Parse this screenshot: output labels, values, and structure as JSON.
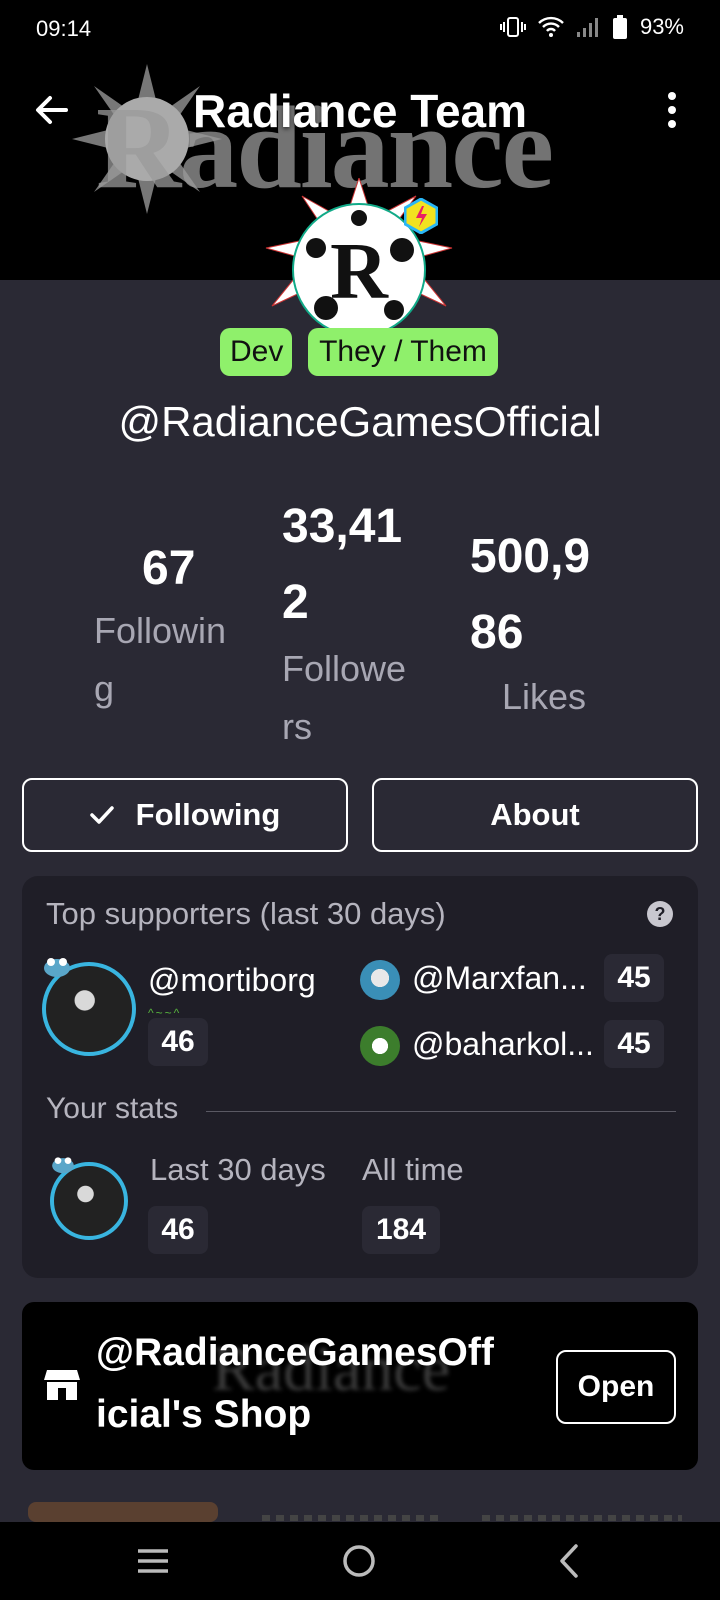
{
  "status_bar": {
    "time": "09:14",
    "battery": "93%"
  },
  "header": {
    "title": "Radiance Team",
    "banner_text": "Radiance"
  },
  "profile": {
    "tags": [
      "Dev",
      "They / Them"
    ],
    "username": "@RadianceGamesOfficial"
  },
  "stats": {
    "following": {
      "value_lines": [
        "67"
      ],
      "label_lines": [
        "Followin",
        "g"
      ]
    },
    "followers": {
      "value_lines": [
        "33,41",
        "2"
      ],
      "label_lines": [
        "Followe",
        "rs"
      ]
    },
    "likes": {
      "value_lines": [
        "500,9",
        "86"
      ],
      "label_lines": [
        "Likes"
      ]
    }
  },
  "actions": {
    "following": "Following",
    "about": "About"
  },
  "supporters": {
    "title": "Top supporters (last 30 days)",
    "top": {
      "name": "@mortiborg",
      "score": "46"
    },
    "others": [
      {
        "name": "@Marxfan...",
        "score": "45"
      },
      {
        "name": "@baharkol...",
        "score": "45"
      }
    ],
    "your_stats_label": "Your stats",
    "last_30_label": "Last 30 days",
    "last_30_value": "46",
    "all_time_label": "All time",
    "all_time_value": "184"
  },
  "shop": {
    "title_lines": [
      "@RadianceGamesOff",
      "icial's Shop"
    ],
    "open_label": "Open"
  },
  "colors": {
    "tag_green": "#8ff06b",
    "avatar_ring": "#39b5e0",
    "background": "#2a2934",
    "card": "#1f1e27"
  }
}
